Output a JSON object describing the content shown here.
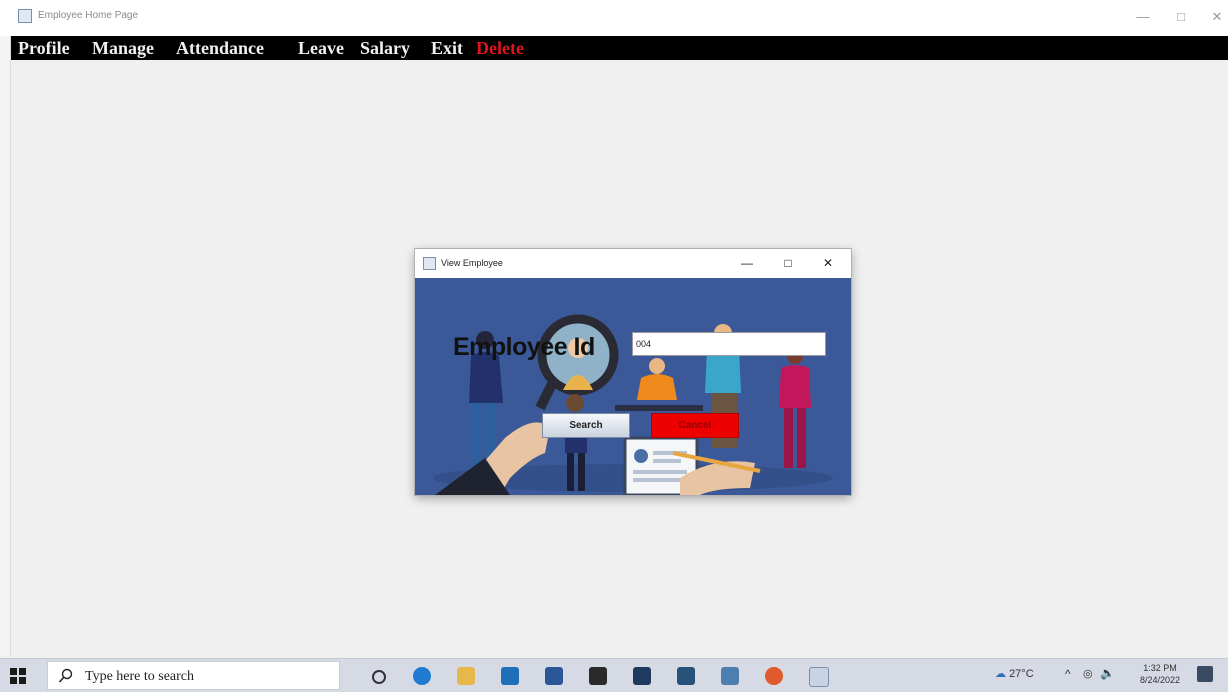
{
  "window": {
    "title": "Employee Home Page"
  },
  "menu": [
    "Profile",
    "Manage",
    "Attendance",
    "Leave",
    "Salary",
    "Exit",
    "Delete"
  ],
  "dialog": {
    "title": "View Employee",
    "label": "Employee Id",
    "input_value": "004",
    "search_label": "Search",
    "cancel_label": "Cancel"
  },
  "taskbar": {
    "search_placeholder": "Type here to search",
    "weather": "27°C",
    "time": "1:32 PM",
    "date": "8/24/2022"
  },
  "colors": {
    "menubar": "#000000",
    "delete": "#e0141c",
    "dialog_bg": "#3b5998",
    "cancel": "#ee0000"
  }
}
